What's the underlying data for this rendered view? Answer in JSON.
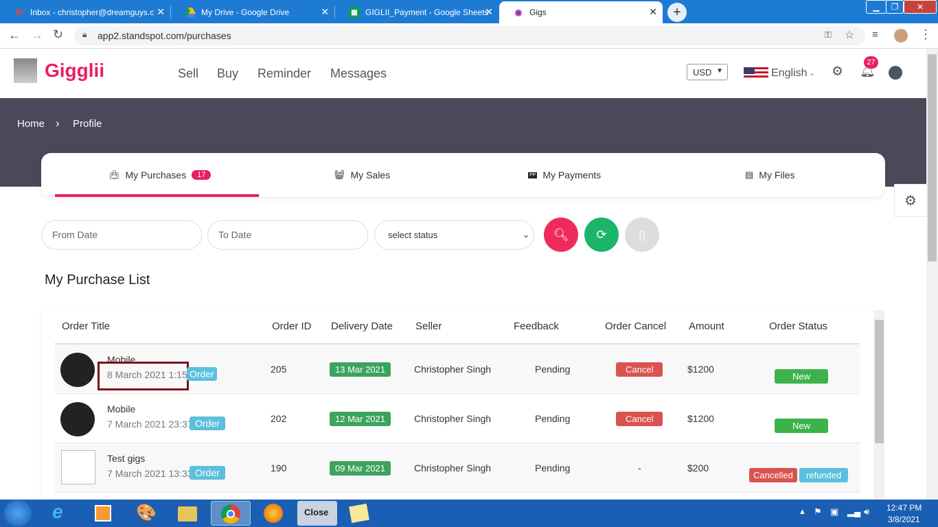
{
  "browser": {
    "tabs": [
      {
        "label": "Inbox - christopher@dreamguys.c",
        "icon": "gmail-icon"
      },
      {
        "label": "My Drive - Google Drive",
        "icon": "drive-icon"
      },
      {
        "label": "GIGLII_Payment - Google Sheets",
        "icon": "sheets-icon"
      },
      {
        "label": "Gigs",
        "icon": "gigs-icon"
      }
    ],
    "url": "app2.standspot.com/purchases"
  },
  "site": {
    "brand": "Gigglii",
    "nav": [
      "Sell",
      "Buy",
      "Reminder",
      "Messages"
    ],
    "currency": "USD",
    "language": "English",
    "notification_count": "27",
    "accent": "#e91e63"
  },
  "breadcrumb": {
    "home": "Home",
    "separator": "›",
    "current": "Profile"
  },
  "profile_tabs": [
    {
      "label": "My Purchases",
      "count": "17"
    },
    {
      "label": "My Sales"
    },
    {
      "label": "My Payments"
    },
    {
      "label": "My Files"
    }
  ],
  "filters": {
    "from_placeholder": "From Date",
    "to_placeholder": "To Date",
    "status_selected": "select status"
  },
  "list_title": "My Purchase List",
  "table": {
    "headers": [
      "Order Title",
      "Order ID",
      "Delivery Date",
      "Seller",
      "Feedback",
      "Order Cancel",
      "Amount",
      "Order Status"
    ],
    "rows": [
      {
        "title": "Mobile",
        "date": "8 March 2021 1:15",
        "tag": "Order",
        "id": "205",
        "delivery": "13 Mar 2021",
        "seller": "Christopher Singh",
        "feedback": "Pending",
        "cancel": "Cancel",
        "amount": "$1200",
        "status": "New",
        "status2": ""
      },
      {
        "title": "Mobile",
        "date": "7 March 2021 23:37",
        "tag": "Order",
        "id": "202",
        "delivery": "12 Mar 2021",
        "seller": "Christopher Singh",
        "feedback": "Pending",
        "cancel": "Cancel",
        "amount": "$1200",
        "status": "New",
        "status2": ""
      },
      {
        "title": "Test gigs",
        "date": "7 March 2021 13:33",
        "tag": "Order",
        "id": "190",
        "delivery": "09 Mar 2021",
        "seller": "Christopher Singh",
        "feedback": "Pending",
        "cancel": "-",
        "amount": "$200",
        "status": "Cancelled",
        "status2": "refunded"
      }
    ]
  },
  "taskbar": {
    "time": "12:47 PM",
    "date": "3/8/2021",
    "close_label": "Close"
  }
}
